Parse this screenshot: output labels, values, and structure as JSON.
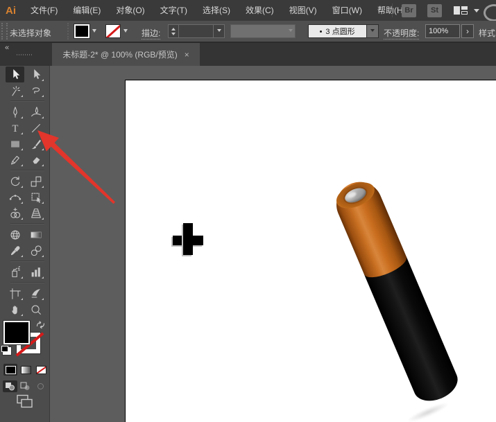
{
  "menu": {
    "logo": "Ai",
    "items": [
      "文件(F)",
      "编辑(E)",
      "对象(O)",
      "文字(T)",
      "选择(S)",
      "效果(C)",
      "视图(V)",
      "窗口(W)",
      "帮助(H)"
    ],
    "bridge_label": "Br",
    "stock_label": "St"
  },
  "control_bar": {
    "status": "未选择对象",
    "stroke_label": "描边:",
    "brush_preview": "3 点圆形",
    "opacity_label": "不透明度:",
    "opacity_value": "100%",
    "expand_arrow": "›",
    "style_label": "样式"
  },
  "tab_bar": {
    "collapse": "«",
    "tab_title": "未标题-2* @ 100% (RGB/预览)",
    "close": "×"
  },
  "toolbar": {
    "tools": [
      "selection",
      "direct-selection",
      "magic-wand",
      "lasso",
      "pen",
      "curvature",
      "type",
      "line-segment",
      "rectangle",
      "paintbrush",
      "shaper",
      "eraser",
      "rotate",
      "scale",
      "width",
      "free-transform",
      "shape-builder",
      "perspective-grid",
      "mesh",
      "gradient",
      "eyedropper",
      "blend",
      "symbol-sprayer",
      "column-graph",
      "artboard",
      "slice",
      "hand",
      "zoom"
    ],
    "selected_tool": "selection"
  },
  "artwork": {
    "plus_color": "#000000",
    "battery_cap_color": "#c2671e",
    "battery_body_color": "#0b0b0b",
    "battery_terminal_color": "#b5b5b5",
    "pointer_arrow_color": "#e2352b"
  },
  "colors": {
    "menubar": "#3a3a3a",
    "controlbar": "#4f4f4f",
    "tabbar": "#343434",
    "tab_active": "#4d4d4d",
    "panel": "#4c4c4c",
    "pasteboard": "#5d5d5d",
    "artboard": "#ffffff",
    "icon": "#c9c9c9",
    "logo_orange": "#d9822f"
  }
}
